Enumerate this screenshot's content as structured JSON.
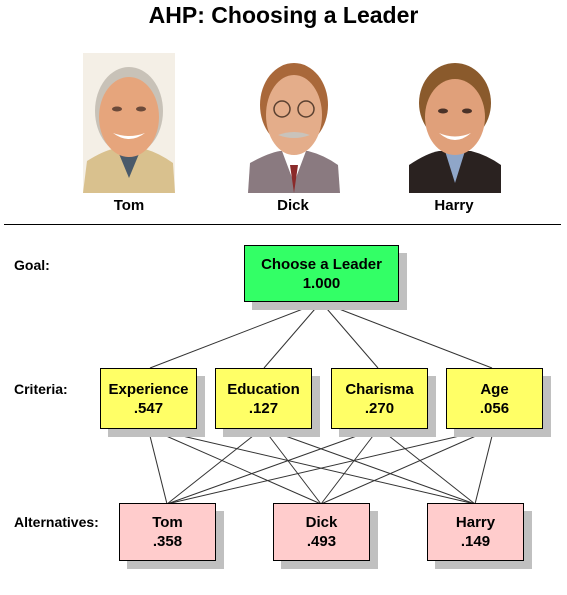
{
  "title": "AHP: Choosing a Leader",
  "candidates": [
    {
      "name": "Tom"
    },
    {
      "name": "Dick"
    },
    {
      "name": "Harry"
    }
  ],
  "levels": {
    "goal_label": "Goal:",
    "criteria_label": "Criteria:",
    "alternatives_label": "Alternatives:"
  },
  "goal": {
    "label": "Choose a Leader",
    "priority": "1.000"
  },
  "criteria": [
    {
      "label": "Experience",
      "priority": ".547"
    },
    {
      "label": "Education",
      "priority": ".127"
    },
    {
      "label": "Charisma",
      "priority": ".270"
    },
    {
      "label": "Age",
      "priority": ".056"
    }
  ],
  "alternatives": [
    {
      "label": "Tom",
      "priority": ".358"
    },
    {
      "label": "Dick",
      "priority": ".493"
    },
    {
      "label": "Harry",
      "priority": ".149"
    }
  ],
  "colors": {
    "goal": "#33ff66",
    "criteria": "#ffff66",
    "alternatives": "#ffcccc",
    "shadow": "#c0c0c0"
  }
}
